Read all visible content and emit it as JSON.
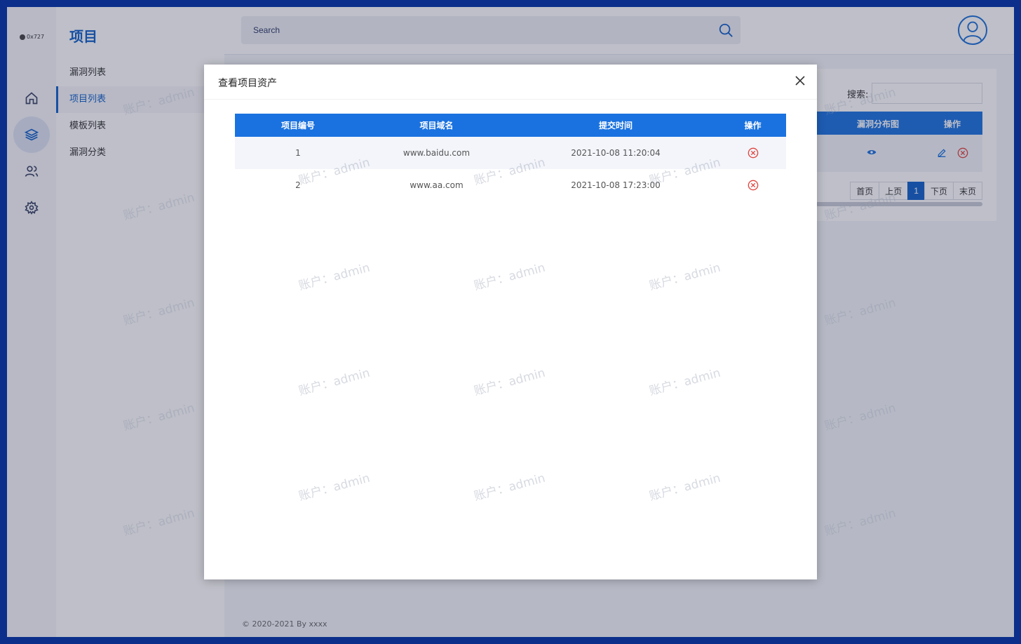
{
  "logo": {
    "text": "0x727"
  },
  "sidebar": {
    "title": "项目",
    "items": [
      {
        "label": "漏洞列表"
      },
      {
        "label": "项目列表"
      },
      {
        "label": "模板列表"
      },
      {
        "label": "漏洞分类"
      }
    ]
  },
  "rail": {
    "icons": [
      "home-icon",
      "layers-icon",
      "users-icon",
      "gear-icon"
    ],
    "active": "layers-icon"
  },
  "topbar": {
    "search_placeholder": "Search"
  },
  "card": {
    "search_label": "搜索:",
    "headers": [
      "漏洞分布图",
      "操作"
    ],
    "pager": [
      "首页",
      "上页",
      "1",
      "下页",
      "末页"
    ]
  },
  "footer": {
    "text": "© 2020-2021 By xxxx"
  },
  "modal": {
    "title": "查看项目资产",
    "columns": [
      "项目编号",
      "项目域名",
      "提交时间",
      "操作"
    ],
    "rows": [
      {
        "id": "1",
        "domain": "www.baidu.com",
        "time": "2021-10-08 11:20:04"
      },
      {
        "id": "2",
        "domain": "www.aa.com",
        "time": "2021-10-08 17:23:00"
      }
    ]
  },
  "watermark": {
    "text": "账户：admin"
  },
  "colors": {
    "accent": "#1160c9",
    "header_blue": "#1a72e0",
    "frame": "#0b2f8a",
    "danger": "#e0443e"
  }
}
